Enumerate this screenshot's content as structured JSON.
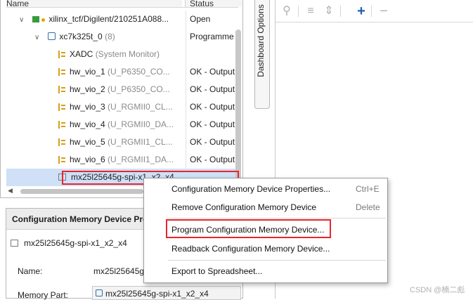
{
  "tree": {
    "header": {
      "name": "Name",
      "status": "Status"
    },
    "rows": [
      {
        "name": "xilinx_tcf/Digilent/210251A088...",
        "suffix": "",
        "status": "Open"
      },
      {
        "name": "xc7k325t_0",
        "suffix": "(8)",
        "status": "Programme"
      },
      {
        "name": "XADC",
        "suffix": "(System Monitor)",
        "status": ""
      },
      {
        "name": "hw_vio_1",
        "suffix": "(U_P6350_CO...",
        "status": "OK - Output"
      },
      {
        "name": "hw_vio_2",
        "suffix": "(U_P6350_CO...",
        "status": "OK - Output"
      },
      {
        "name": "hw_vio_3",
        "suffix": "(U_RGMII0_CL...",
        "status": "OK - Output"
      },
      {
        "name": "hw_vio_4",
        "suffix": "(U_RGMII0_DA...",
        "status": "OK - Output"
      },
      {
        "name": "hw_vio_5",
        "suffix": "(U_RGMII1_CL...",
        "status": "OK - Output"
      },
      {
        "name": "hw_vio_6",
        "suffix": "(U_RGMII1_DA...",
        "status": "OK - Output"
      },
      {
        "name": "mx25l25645g-spi-x1_x2_x4",
        "suffix": "",
        "status": ""
      }
    ]
  },
  "properties": {
    "title": "Configuration Memory Device Pro",
    "device": "mx25l25645g-spi-x1_x2_x4",
    "name_label": "Name:",
    "name_value": "mx25l25645g",
    "part_label": "Memory Part:",
    "part_value": "mx25l25645g-spi-x1_x2_x4"
  },
  "side_tab": {
    "label": "Dashboard Options"
  },
  "context_menu": {
    "items": [
      {
        "label": "Configuration Memory Device Properties...",
        "shortcut": "Ctrl+E"
      },
      {
        "label": "Remove Configuration Memory Device",
        "shortcut": "Delete"
      },
      {
        "label": "Program Configuration Memory Device...",
        "shortcut": ""
      },
      {
        "label": "Readback Configuration Memory Device...",
        "shortcut": ""
      },
      {
        "label": "Export to Spreadsheet...",
        "shortcut": ""
      }
    ]
  },
  "watermark": "CSDN @楠二彪",
  "colors": {
    "highlight": "#e8262b",
    "selection": "#cfe0f7",
    "toolbar_active": "#1a5fb4"
  }
}
